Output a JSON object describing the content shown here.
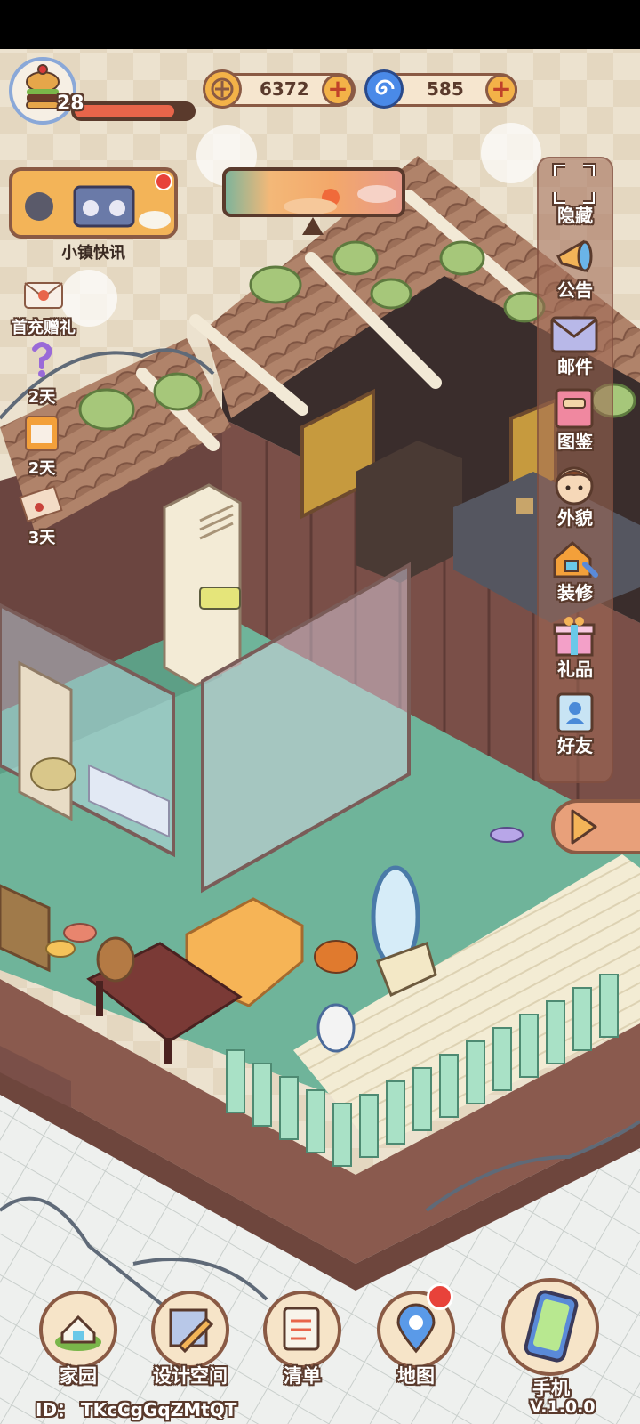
{
  "player": {
    "level": "28",
    "avatar_icon": "burger-icon"
  },
  "currencies": {
    "coins": {
      "value": "6372",
      "icon": "coin-icon"
    },
    "gems": {
      "value": "585",
      "icon": "swirl-gem-icon"
    }
  },
  "news": {
    "label": "小镇快讯"
  },
  "left_items": [
    {
      "label": "首充赠礼",
      "icon": "gift-envelope-icon"
    },
    {
      "label": "2天",
      "icon": "question-ribbon-icon"
    },
    {
      "label": "2天",
      "icon": "cat-box-icon"
    },
    {
      "label": "3天",
      "icon": "letter-icon"
    }
  ],
  "side_menu": [
    {
      "label": "隐藏",
      "icon": "hide-frame-icon"
    },
    {
      "label": "公告",
      "icon": "megaphone-icon"
    },
    {
      "label": "邮件",
      "icon": "mail-icon"
    },
    {
      "label": "图鉴",
      "icon": "book-icon"
    },
    {
      "label": "外貌",
      "icon": "character-face-icon"
    },
    {
      "label": "装修",
      "icon": "house-wrench-icon"
    },
    {
      "label": "礼品",
      "icon": "gift-box-icon"
    },
    {
      "label": "好友",
      "icon": "friend-book-icon"
    }
  ],
  "bottom_nav": [
    {
      "label": "家园",
      "icon": "home-icon"
    },
    {
      "label": "设计空间",
      "icon": "design-ruler-icon"
    },
    {
      "label": "清单",
      "icon": "checklist-icon"
    },
    {
      "label": "地图",
      "icon": "map-pin-icon"
    },
    {
      "label": "手机",
      "icon": "phone-icon"
    }
  ],
  "footer": {
    "player_id": "ID： TKcCgGqZMtQT",
    "version": "V.1.0.0"
  },
  "colors": {
    "floor": "#6fb49a",
    "wall": "#7a4f48",
    "roof": "#b08463",
    "background": "#ece2cf",
    "fence": "#a9e1c6"
  }
}
